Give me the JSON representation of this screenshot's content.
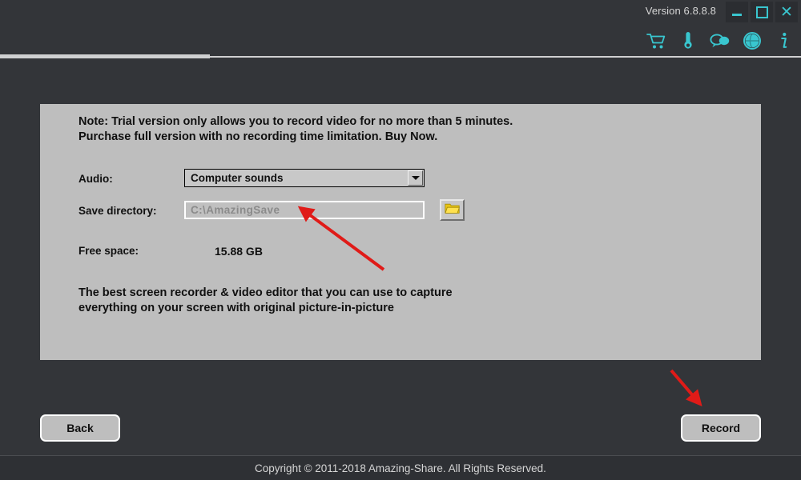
{
  "window": {
    "version_label": "Version 6.8.8.8",
    "minimize_label": "Minimize",
    "maximize_label": "Maximize",
    "close_label": "Close"
  },
  "toolbar": {
    "icons": [
      {
        "name": "cart-icon",
        "tooltip": "Buy"
      },
      {
        "name": "key-icon",
        "tooltip": "Register"
      },
      {
        "name": "feedback-icon",
        "tooltip": "Feedback"
      },
      {
        "name": "globe-icon",
        "tooltip": "Language"
      },
      {
        "name": "info-icon",
        "tooltip": "About"
      }
    ]
  },
  "panel": {
    "note_line1": "Note: Trial version only allows you to record video for no more than 5 minutes.",
    "note_line2": "Purchase full version with no recording time limitation. Buy Now.",
    "audio_label": "Audio:",
    "audio_value": "Computer sounds",
    "audio_options": [
      "Computer sounds"
    ],
    "save_label": "Save directory:",
    "save_placeholder": "C:\\AmazingSave",
    "save_value": "",
    "browse_icon": "folder-icon",
    "free_space_label": "Free space:",
    "free_space_value": "15.88 GB",
    "tagline_line1": "The best screen recorder & video editor that you can use to capture",
    "tagline_line2": "everything on your screen with original picture-in-picture"
  },
  "actions": {
    "back_label": "Back",
    "record_label": "Record"
  },
  "footer": {
    "copyright": "Copyright © 2011-2018 Amazing-Share. All Rights Reserved."
  },
  "colors": {
    "accent": "#39c6cf",
    "window_bg": "#333539",
    "panel_bg": "#bebebe",
    "annotation": "#e01b18",
    "folder": "#e8c413"
  }
}
